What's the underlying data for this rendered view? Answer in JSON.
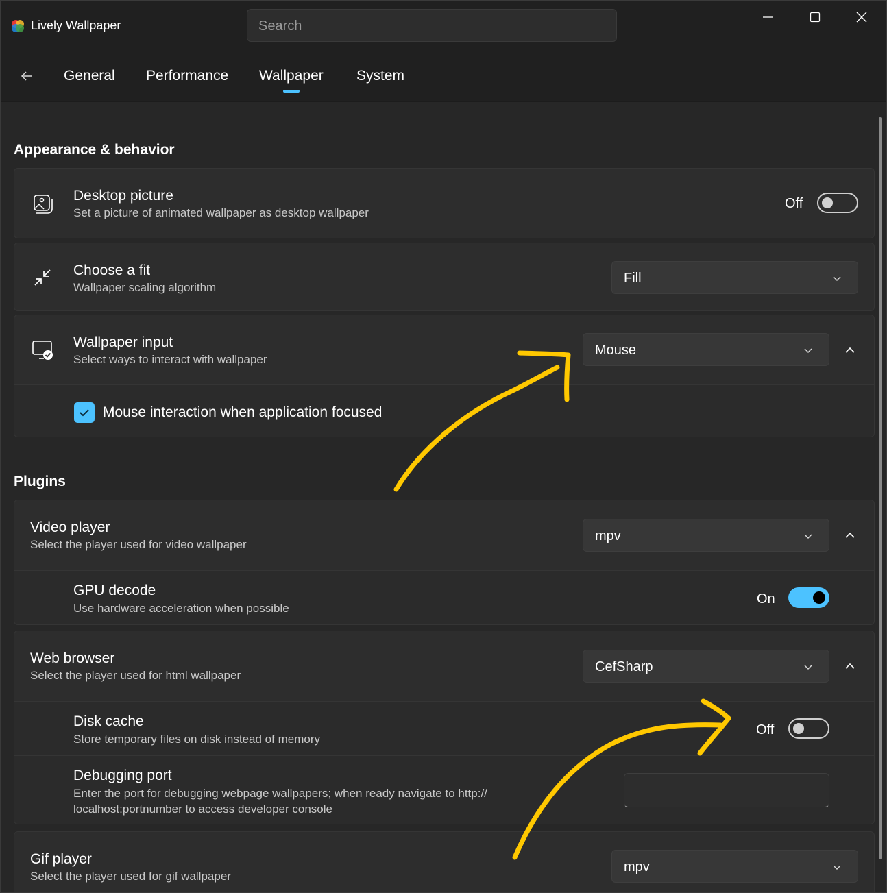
{
  "app": {
    "title": "Lively Wallpaper",
    "logo_icon": "lively-logo-icon"
  },
  "search": {
    "placeholder": "Search"
  },
  "window_controls": {
    "minimize_icon": "minimize-icon",
    "maximize_icon": "maximize-icon",
    "close_icon": "close-icon"
  },
  "nav": {
    "back_icon": "back-arrow-icon",
    "tabs": [
      {
        "label": "General"
      },
      {
        "label": "Performance"
      },
      {
        "label": "Wallpaper",
        "active": true
      },
      {
        "label": "System"
      }
    ],
    "accent": "#4cc2ff"
  },
  "appearance": {
    "title": "Appearance & behavior",
    "desktop_picture": {
      "title": "Desktop picture",
      "desc": "Set a picture of animated wallpaper as desktop wallpaper",
      "state": "Off",
      "icon": "picture-icon"
    },
    "choose_fit": {
      "title": "Choose a fit",
      "desc": "Wallpaper scaling algorithm",
      "value": "Fill",
      "icon": "shrink-arrows-icon"
    },
    "wallpaper_input": {
      "title": "Wallpaper input",
      "desc": "Select ways to interact with wallpaper",
      "value": "Mouse",
      "icon": "monitor-check-icon",
      "checkbox_label": "Mouse interaction when application focused",
      "checkbox_checked": true
    }
  },
  "plugins": {
    "title": "Plugins",
    "video_player": {
      "title": "Video player",
      "desc": "Select the player used for video wallpaper",
      "value": "mpv"
    },
    "gpu_decode": {
      "title": "GPU decode",
      "desc": "Use hardware acceleration when possible",
      "state": "On"
    },
    "web_browser": {
      "title": "Web browser",
      "desc": "Select the player used for html wallpaper",
      "value": "CefSharp"
    },
    "disk_cache": {
      "title": "Disk cache",
      "desc": "Store temporary files on disk instead of memory",
      "state": "Off"
    },
    "debugging_port": {
      "title": "Debugging port",
      "desc_line1": "Enter the port for debugging webpage wallpapers; when ready navigate to http://",
      "desc_line2": "localhost:portnumber to access developer console",
      "value": ""
    },
    "gif_player": {
      "title": "Gif player",
      "desc": "Select the player used for gif wallpaper",
      "value": "mpv"
    }
  },
  "annotation_color": "#ffc800"
}
